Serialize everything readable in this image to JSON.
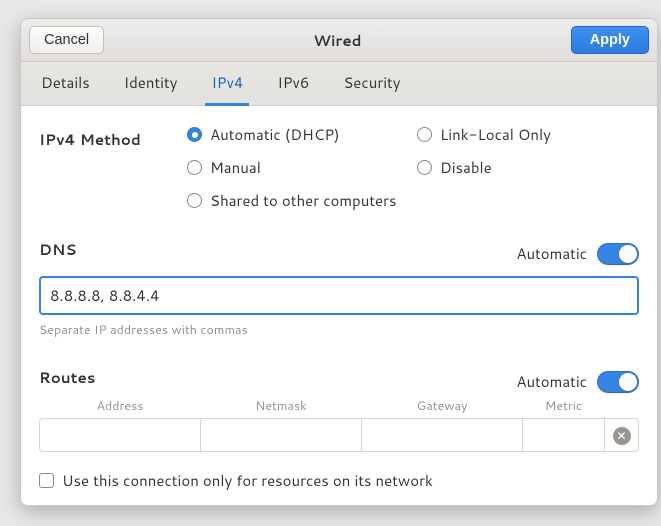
{
  "titlebar": {
    "cancel": "Cancel",
    "title": "Wired",
    "apply": "Apply"
  },
  "tabs": [
    {
      "id": "details",
      "label": "Details",
      "active": false
    },
    {
      "id": "identity",
      "label": "Identity",
      "active": false
    },
    {
      "id": "ipv4",
      "label": "IPv4",
      "active": true
    },
    {
      "id": "ipv6",
      "label": "IPv6",
      "active": false
    },
    {
      "id": "security",
      "label": "Security",
      "active": false
    }
  ],
  "ipv4_method": {
    "title": "IPv4 Method",
    "options": {
      "auto": "Automatic (DHCP)",
      "linklocal": "Link-Local Only",
      "manual": "Manual",
      "disable": "Disable",
      "shared": "Shared to other computers"
    },
    "selected": "auto"
  },
  "dns": {
    "title": "DNS",
    "automatic_label": "Automatic",
    "automatic_on": true,
    "value": "8.8.8.8, 8.8.4.4",
    "hint": "Separate IP addresses with commas"
  },
  "routes": {
    "title": "Routes",
    "automatic_label": "Automatic",
    "automatic_on": true,
    "headers": {
      "address": "Address",
      "netmask": "Netmask",
      "gateway": "Gateway",
      "metric": "Metric"
    },
    "rows": [
      {
        "address": "",
        "netmask": "",
        "gateway": "",
        "metric": ""
      }
    ],
    "only_local_label": "Use this connection only for resources on its network",
    "only_local_checked": false
  }
}
